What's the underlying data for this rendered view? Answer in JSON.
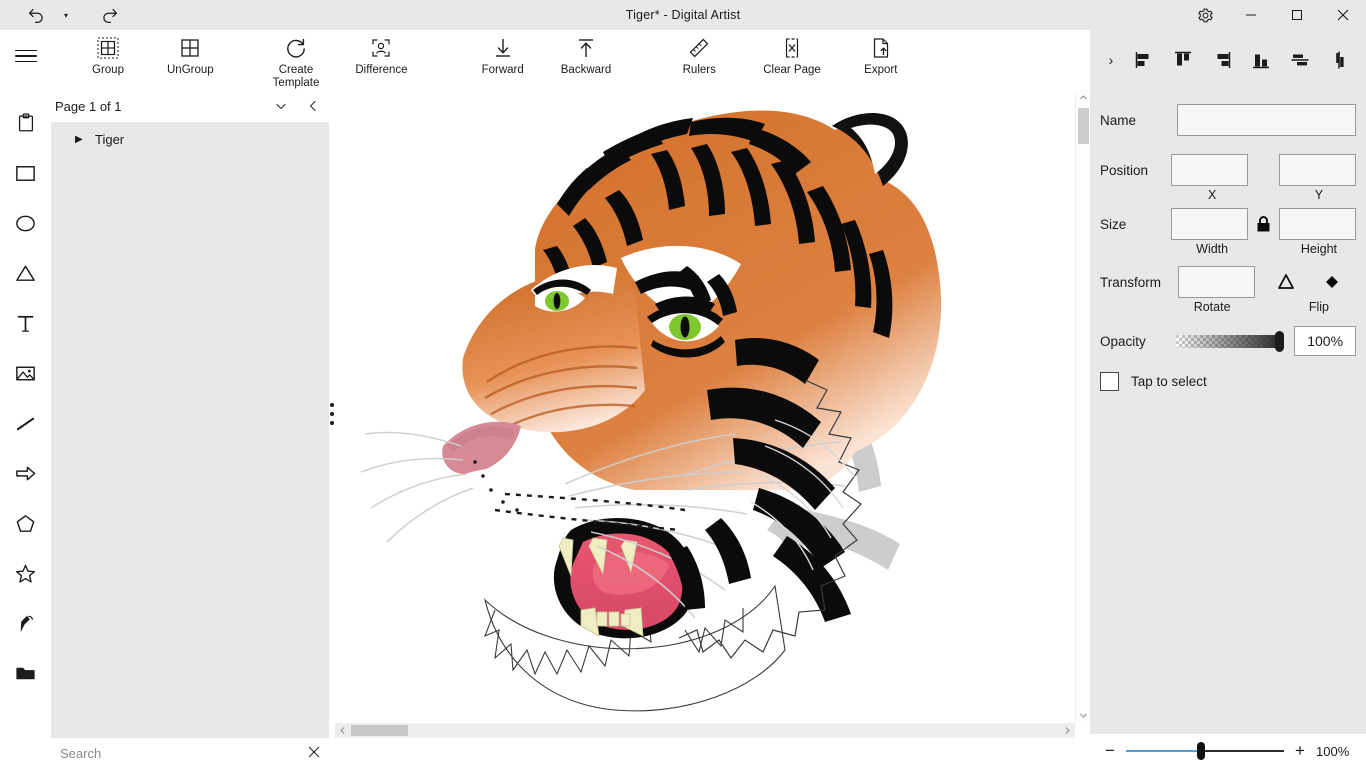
{
  "titlebar": {
    "title": "Tiger*  -  Digital Artist",
    "undo_label": "undo-arrow",
    "undo_dropdown_label": "▾",
    "redo_label": "redo-arrow",
    "settings_label": "gear",
    "minimize_label": "—",
    "maximize_label": "▢",
    "close_label": "✕"
  },
  "ribbon": {
    "menu_label": "hamburger-menu",
    "items": [
      {
        "label": "Group",
        "icon": "group-icon"
      },
      {
        "label": "UnGroup",
        "icon": "ungroup-icon"
      },
      {
        "label": "Create\nTemplate",
        "icon": "create-template-icon"
      },
      {
        "label": "Difference",
        "icon": "difference-icon"
      },
      {
        "label": "Forward",
        "icon": "forward-arrow-icon"
      },
      {
        "label": "Backward",
        "icon": "backward-arrow-icon"
      },
      {
        "label": "Rulers",
        "icon": "ruler-icon"
      },
      {
        "label": "Clear Page",
        "icon": "clear-page-icon"
      },
      {
        "label": "Export",
        "icon": "export-icon"
      }
    ]
  },
  "align_toolbar": {
    "expand_label": "›",
    "buttons": [
      {
        "name": "align-left-icon"
      },
      {
        "name": "align-top-icon"
      },
      {
        "name": "align-right-icon"
      },
      {
        "name": "align-bottom-icon"
      },
      {
        "name": "distribute-horizontal-icon"
      },
      {
        "name": "distribute-vertical-icon"
      }
    ]
  },
  "tools": [
    {
      "name": "clipboard-tool",
      "icon": "clipboard-icon"
    },
    {
      "name": "rectangle-tool",
      "icon": "rectangle-icon"
    },
    {
      "name": "ellipse-tool",
      "icon": "ellipse-icon"
    },
    {
      "name": "triangle-tool",
      "icon": "triangle-icon"
    },
    {
      "name": "text-tool",
      "icon": "text-icon"
    },
    {
      "name": "image-tool",
      "icon": "image-icon"
    },
    {
      "name": "line-tool",
      "icon": "line-icon"
    },
    {
      "name": "arrow-tool",
      "icon": "arrow-icon"
    },
    {
      "name": "pentagon-tool",
      "icon": "pentagon-icon"
    },
    {
      "name": "star-tool",
      "icon": "star-icon"
    },
    {
      "name": "pen-tool",
      "icon": "pen-icon"
    },
    {
      "name": "folder-tool",
      "icon": "folder-icon"
    }
  ],
  "layer_panel": {
    "page_label": "Page 1 of 1",
    "chevron_down": "⌄",
    "chevron_left": "‹",
    "layers": [
      {
        "name": "Tiger",
        "expand_arrow": "▶"
      }
    ],
    "search_placeholder": "Search",
    "search_value": "",
    "search_clear": "✕"
  },
  "canvas": {
    "artwork_name": "tiger-head-artwork",
    "background": "#ffffff",
    "colors": {
      "fur_orange": "#d2702a",
      "fur_orange_light": "#e08a45",
      "black": "#000000",
      "eye_green": "#7ec82e",
      "tongue_pink": "#e8566f",
      "mouth_pink": "#d95c76",
      "nose_pink": "#d58a96",
      "tooth_cream": "#efeec3",
      "shadow_gray": "#c8c8c8"
    }
  },
  "properties": {
    "name_label": "Name",
    "name_value": "",
    "position_label": "Position",
    "position_x_value": "",
    "position_y_value": "",
    "x_sublabel": "X",
    "y_sublabel": "Y",
    "size_label": "Size",
    "width_value": "",
    "height_value": "",
    "width_sublabel": "Width",
    "height_sublabel": "Height",
    "lock_icon": "lock-icon",
    "transform_label": "Transform",
    "rotate_value": "",
    "rotate_sublabel": "Rotate",
    "flip_sublabel": "Flip",
    "flip_vertical_icon": "flip-vertical-icon",
    "flip_horizontal_icon": "flip-horizontal-icon",
    "opacity_label": "Opacity",
    "opacity_value": "100%",
    "opacity_percent": 100,
    "tap_to_select_label": "Tap to select",
    "tap_to_select_checked": false
  },
  "zoombar": {
    "minus_label": "−",
    "plus_label": "+",
    "zoom_value": "100%",
    "zoom_percent": 100
  }
}
